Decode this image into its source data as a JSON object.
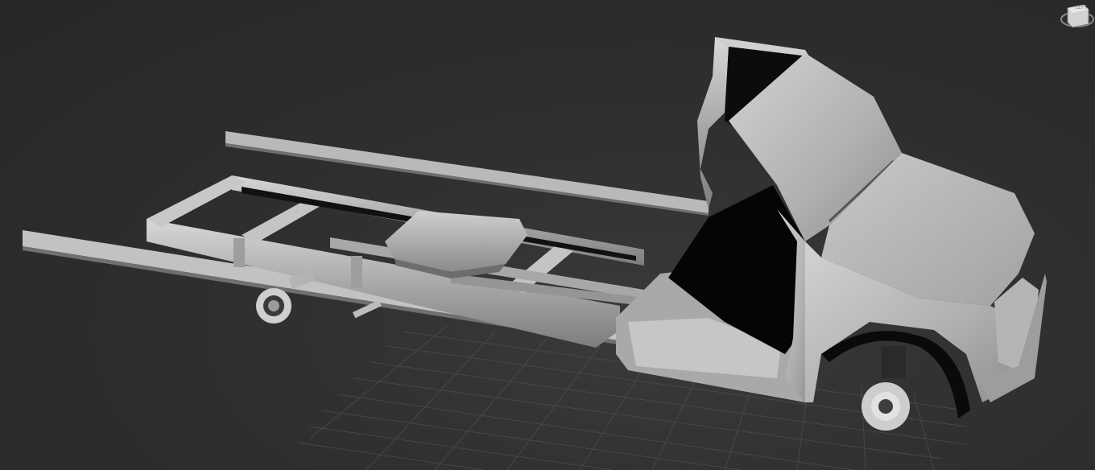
{
  "viewport": {
    "mode": "perspective",
    "shading": "default-shading",
    "background_color": "#2e2e2e",
    "grid_color": "#4a4a4a"
  },
  "viewcube": {
    "face_label": "LEFT",
    "icon": "viewcube-icon"
  },
  "model": {
    "name_icon": "truck-chassis-model",
    "material_color": "#b5b5b5"
  }
}
